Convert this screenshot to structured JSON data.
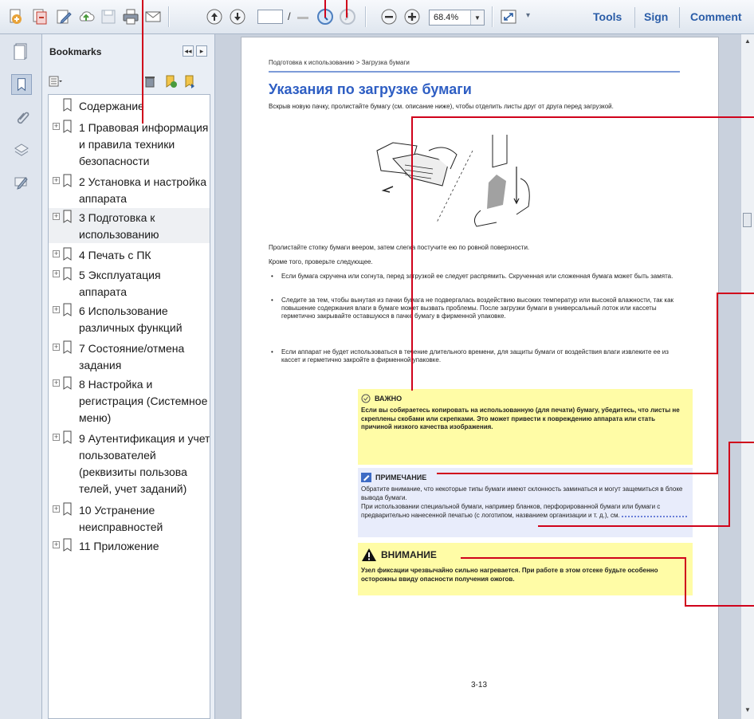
{
  "toolbar": {
    "tools_label": "Tools",
    "sign_label": "Sign",
    "comment_label": "Comment",
    "page_separator": "/",
    "zoom_value": "68.4%"
  },
  "bookmarks": {
    "title": "Bookmarks",
    "items": [
      {
        "label": "Содержание",
        "expandable": false
      },
      {
        "label": "1 Правовая информация и правила техники безопасности",
        "expandable": true
      },
      {
        "label": "2 Установка и настройка аппарата",
        "expandable": true
      },
      {
        "label": "3 Подготовка к использованию",
        "expandable": true,
        "selected": true
      },
      {
        "label": "4 Печать с ПК",
        "expandable": true
      },
      {
        "label": "5 Эксплуатация аппарата",
        "expandable": true
      },
      {
        "label": "6 Использование различных функций",
        "expandable": true
      },
      {
        "label": "7 Состояние/отмена задания",
        "expandable": true
      },
      {
        "label": "8 Настройка и регистрация (Системное меню)",
        "expandable": true
      },
      {
        "label": "9 Аутентификация и учет пользователей (реквизиты пользова телей, учет заданий)",
        "expandable": true
      },
      {
        "label": "10 Устранение неисправностей",
        "expandable": true
      },
      {
        "label": "11 Приложение",
        "expandable": true
      }
    ]
  },
  "document": {
    "breadcrumb": "Подготовка к использованию > Загрузка бумаги",
    "title": "Указания по загрузке бумаги",
    "intro": "Вскрыв новую пачку, пролистайте бумагу (см. описание ниже), чтобы отделить листы друг от друга перед загрузкой.",
    "para1": "Пролистайте стопку бумаги веером, затем слегка постучите ею по ровной поверхности.",
    "para2": "Кроме того, проверьте следующее.",
    "bullets": [
      "Если бумага скручена или согнута, перед загрузкой ее следует распрямить. Скрученная или сложенная бумага может быть замята.",
      "Следите за тем, чтобы вынутая из пачки бумага не подвергалась воздействию высоких температур или высокой влажности, так как повышение содержания влаги в бумаге может вызвать проблемы. После загрузки бумаги в универсальный лоток или кассеты герметично закрывайте оставшуюся в пачке бумагу в фирменной упаковке.",
      "Если аппарат не будет использоваться в течение длительного времени, для защиты бумаги от воздействия влаги извлеките ее из кассет и герметично закройте в фирменной упаковке."
    ],
    "important": {
      "heading": "ВАЖНО",
      "text": "Если вы собираетесь копировать на использованную (для печати) бумагу, убедитесь, что листы не скреплены скобами или скрепками. Это может привести к повреждению аппарата или стать причиной низкого качества изображения."
    },
    "note": {
      "heading": "ПРИМЕЧАНИЕ",
      "line1": "Обратите внимание, что некоторые типы бумаги имеют склонность заминаться и могут защемиться в блоке вывода бумаги.",
      "line2": "При использовании специальной бумаги, например бланков, перфорированной бумаги или бумаги с предварительно нанесенной печатью (с логотипом, названием организации и т. д.), см."
    },
    "caution": {
      "heading": "ВНИМАНИЕ",
      "text": "Узел фиксации чрезвычайно сильно нагревается. При работе в этом отсеке будьте особенно осторожны ввиду опасности получения ожогов."
    },
    "page_number": "3-13"
  },
  "colors": {
    "title_blue": "#2e5ec3",
    "link_blue": "#2b5da8",
    "callout_red": "#d0021b",
    "important_bg": "#fffca6",
    "note_bg": "#e8ecfb"
  }
}
